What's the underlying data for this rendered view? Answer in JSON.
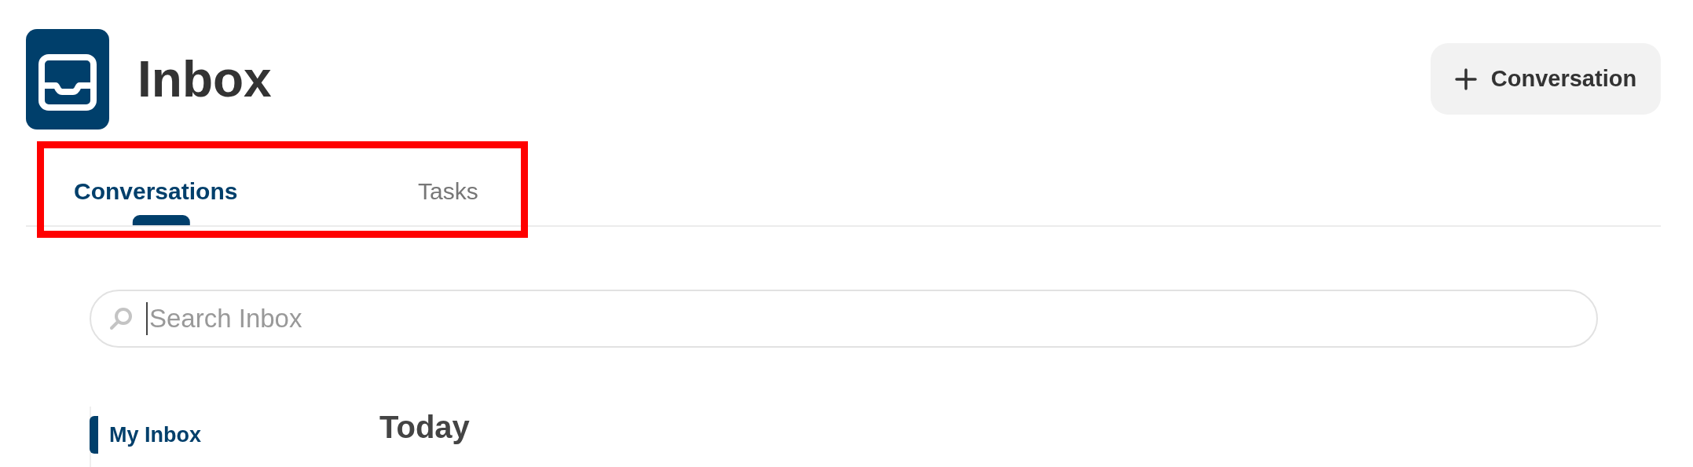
{
  "header": {
    "title": "Inbox",
    "new_button": "Conversation"
  },
  "tabs": [
    {
      "label": "Conversations",
      "selected": true
    },
    {
      "label": "Tasks",
      "selected": false
    }
  ],
  "search": {
    "placeholder": "Search Inbox"
  },
  "sidebar": {
    "items": [
      {
        "label": "My Inbox",
        "selected": true
      }
    ]
  },
  "section_heading": "Today"
}
